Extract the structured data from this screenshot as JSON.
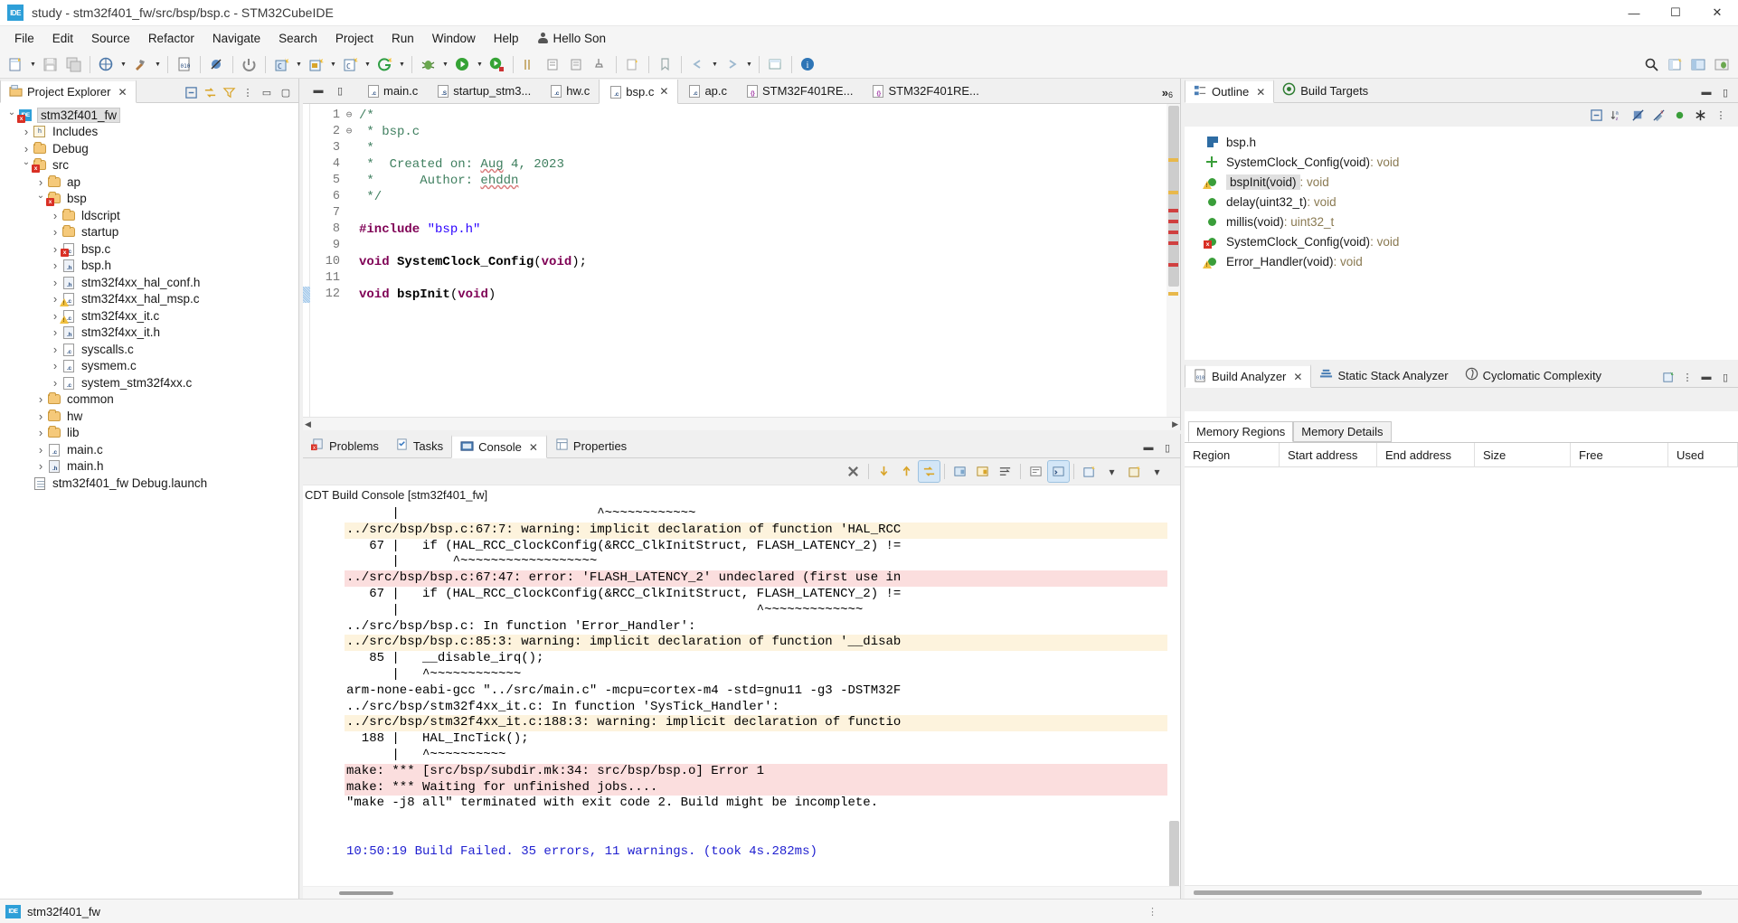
{
  "window": {
    "title": "study - stm32f401_fw/src/bsp/bsp.c - STM32CubeIDE",
    "app_badge": "IDE",
    "minimize": "—",
    "maximize": "☐",
    "close": "✕"
  },
  "menu": {
    "items": [
      "File",
      "Edit",
      "Source",
      "Refactor",
      "Navigate",
      "Search",
      "Project",
      "Run",
      "Window",
      "Help"
    ],
    "user": "Hello Son"
  },
  "toolbar": {
    "groups": [
      {
        "name": "new",
        "icons": [
          "new-file-icon"
        ],
        "dropdown": true
      },
      {
        "name": "save",
        "icons": [
          "save-icon",
          "save-all-icon"
        ],
        "dropdown": false
      },
      {
        "name": "build-tools",
        "icons": [
          "build-project-icon"
        ],
        "dropdown": true
      },
      {
        "name": "hammer",
        "icons": [
          "build-hammer-icon"
        ],
        "dropdown": true
      },
      {
        "name": "binary",
        "icons": [
          "binary-icon"
        ],
        "dropdown": false
      },
      {
        "name": "skip",
        "icons": [
          "skip-breakpoints-icon"
        ],
        "dropdown": false
      },
      {
        "name": "stop",
        "icons": [
          "terminate-icon"
        ],
        "dropdown": false
      },
      {
        "name": "launch-c",
        "icons": [
          "debug-config-icon"
        ],
        "dropdown": true
      },
      {
        "name": "launch-c2",
        "icons": [
          "run-config-icon"
        ],
        "dropdown": true
      },
      {
        "name": "launch-c3",
        "icons": [
          "new-c-project-icon"
        ],
        "dropdown": true
      },
      {
        "name": "g",
        "icons": [
          "generate-code-icon"
        ],
        "dropdown": true
      },
      {
        "name": "debug",
        "icons": [
          "debug-bug-icon"
        ],
        "dropdown": true
      },
      {
        "name": "run",
        "icons": [
          "run-play-icon"
        ],
        "dropdown": true
      },
      {
        "name": "run2",
        "icons": [
          "run-external-icon"
        ],
        "dropdown": false
      }
    ],
    "right_icons": [
      "search-icon",
      "open-perspective-icon",
      "perspective-cdt-icon",
      "perspective-debug-icon"
    ]
  },
  "explorer": {
    "tab": "Project Explorer",
    "tools": [
      "collapse-all-icon",
      "link-with-editor-icon",
      "filter-icon",
      "view-menu-icon",
      "minimize-icon",
      "maximize-icon"
    ],
    "tree": [
      {
        "label": "stm32f401_fw",
        "depth": 0,
        "twisty": "open",
        "icon": "ide-project-icon",
        "badge": "error",
        "selected": true
      },
      {
        "label": "Includes",
        "depth": 1,
        "twisty": "closed",
        "icon": "includes-icon",
        "badge": ""
      },
      {
        "label": "Debug",
        "depth": 1,
        "twisty": "closed",
        "icon": "folder-icon",
        "badge": ""
      },
      {
        "label": "src",
        "depth": 1,
        "twisty": "open",
        "icon": "folder-icon",
        "badge": "error"
      },
      {
        "label": "ap",
        "depth": 2,
        "twisty": "closed",
        "icon": "folder-icon",
        "badge": ""
      },
      {
        "label": "bsp",
        "depth": 2,
        "twisty": "open",
        "icon": "folder-icon",
        "badge": "error"
      },
      {
        "label": "ldscript",
        "depth": 3,
        "twisty": "closed",
        "icon": "folder-icon",
        "badge": ""
      },
      {
        "label": "startup",
        "depth": 3,
        "twisty": "closed",
        "icon": "folder-icon",
        "badge": ""
      },
      {
        "label": "bsp.c",
        "depth": 3,
        "twisty": "closed",
        "icon": "c-file-icon",
        "badge": "error"
      },
      {
        "label": "bsp.h",
        "depth": 3,
        "twisty": "closed",
        "icon": "h-file-icon",
        "badge": ""
      },
      {
        "label": "stm32f4xx_hal_conf.h",
        "depth": 3,
        "twisty": "closed",
        "icon": "h-file-icon",
        "badge": ""
      },
      {
        "label": "stm32f4xx_hal_msp.c",
        "depth": 3,
        "twisty": "closed",
        "icon": "c-file-icon",
        "badge": "warning"
      },
      {
        "label": "stm32f4xx_it.c",
        "depth": 3,
        "twisty": "closed",
        "icon": "c-file-icon",
        "badge": "warning"
      },
      {
        "label": "stm32f4xx_it.h",
        "depth": 3,
        "twisty": "closed",
        "icon": "h-file-icon",
        "badge": ""
      },
      {
        "label": "syscalls.c",
        "depth": 3,
        "twisty": "closed",
        "icon": "c-file-icon",
        "badge": ""
      },
      {
        "label": "sysmem.c",
        "depth": 3,
        "twisty": "closed",
        "icon": "c-file-icon",
        "badge": ""
      },
      {
        "label": "system_stm32f4xx.c",
        "depth": 3,
        "twisty": "closed",
        "icon": "c-file-icon",
        "badge": ""
      },
      {
        "label": "common",
        "depth": 2,
        "twisty": "closed",
        "icon": "folder-icon",
        "badge": ""
      },
      {
        "label": "hw",
        "depth": 2,
        "twisty": "closed",
        "icon": "folder-icon",
        "badge": ""
      },
      {
        "label": "lib",
        "depth": 2,
        "twisty": "closed",
        "icon": "folder-icon",
        "badge": ""
      },
      {
        "label": "main.c",
        "depth": 2,
        "twisty": "closed",
        "icon": "c-file-icon",
        "badge": ""
      },
      {
        "label": "main.h",
        "depth": 2,
        "twisty": "closed",
        "icon": "h-file-icon",
        "badge": ""
      },
      {
        "label": "stm32f401_fw Debug.launch",
        "depth": 1,
        "twisty": "none",
        "icon": "launch-file-icon",
        "badge": ""
      }
    ]
  },
  "editor": {
    "tabs": [
      {
        "label": "main.c",
        "icon": "c-file-icon",
        "active": false,
        "closable": false
      },
      {
        "label": "startup_stm3...",
        "icon": "s-file-icon",
        "active": false,
        "closable": false
      },
      {
        "label": "hw.c",
        "icon": "c-file-icon",
        "active": false,
        "closable": false
      },
      {
        "label": "bsp.c",
        "icon": "c-file-icon",
        "active": true,
        "closable": true
      },
      {
        "label": "ap.c",
        "icon": "c-file-icon",
        "active": false,
        "closable": false
      },
      {
        "label": "STM32F401RE...",
        "icon": "ioc-file-icon",
        "active": false,
        "closable": false
      },
      {
        "label": "STM32F401RE...",
        "icon": "ioc-file-icon",
        "active": false,
        "closable": false
      }
    ],
    "overflow_label": "»",
    "overflow_count": "6",
    "lines": [
      {
        "no": "1",
        "fold": "⊖",
        "tokens": [
          {
            "t": "/*",
            "c": "c-com"
          }
        ]
      },
      {
        "no": "2",
        "fold": "",
        "tokens": [
          {
            "t": " * bsp.c",
            "c": "c-com"
          }
        ]
      },
      {
        "no": "3",
        "fold": "",
        "tokens": [
          {
            "t": " *",
            "c": "c-com"
          }
        ]
      },
      {
        "no": "4",
        "fold": "",
        "tokens": [
          {
            "t": " *  Created on: ",
            "c": "c-com"
          },
          {
            "t": "Aug",
            "c": "c-com sq"
          },
          {
            "t": " 4, 2023",
            "c": "c-com"
          }
        ]
      },
      {
        "no": "5",
        "fold": "",
        "tokens": [
          {
            "t": " *      Author: ",
            "c": "c-com"
          },
          {
            "t": "ehddn",
            "c": "c-com sq"
          }
        ]
      },
      {
        "no": "6",
        "fold": "",
        "tokens": [
          {
            "t": " */",
            "c": "c-com"
          }
        ]
      },
      {
        "no": "7",
        "fold": "",
        "tokens": [
          {
            "t": "",
            "c": "c-pl"
          }
        ]
      },
      {
        "no": "8",
        "fold": "",
        "tokens": [
          {
            "t": "#include ",
            "c": "c-pre"
          },
          {
            "t": "\"bsp.h\"",
            "c": "c-str"
          }
        ]
      },
      {
        "no": "9",
        "fold": "",
        "tokens": [
          {
            "t": "",
            "c": "c-pl"
          }
        ]
      },
      {
        "no": "10",
        "fold": "",
        "tokens": [
          {
            "t": "void",
            "c": "c-kw"
          },
          {
            "t": " ",
            "c": "c-pl"
          },
          {
            "t": "SystemClock_Config",
            "c": "c-fn"
          },
          {
            "t": "(",
            "c": "c-pl"
          },
          {
            "t": "void",
            "c": "c-kw"
          },
          {
            "t": ");",
            "c": "c-pl"
          }
        ]
      },
      {
        "no": "11",
        "fold": "",
        "tokens": [
          {
            "t": "",
            "c": "c-pl"
          }
        ]
      },
      {
        "no": "12",
        "fold": "⊖",
        "tokens": [
          {
            "t": "void",
            "c": "c-kw"
          },
          {
            "t": " ",
            "c": "c-pl"
          },
          {
            "t": "bspInit",
            "c": "c-fn"
          },
          {
            "t": "(",
            "c": "c-pl"
          },
          {
            "t": "void",
            "c": "c-kw"
          },
          {
            "t": ")",
            "c": "c-pl"
          }
        ]
      }
    ]
  },
  "bottom": {
    "tabs": [
      {
        "label": "Problems",
        "icon": "problems-icon",
        "active": false,
        "closable": false
      },
      {
        "label": "Tasks",
        "icon": "tasks-icon",
        "active": false,
        "closable": false
      },
      {
        "label": "Console",
        "icon": "console-icon",
        "active": true,
        "closable": true
      },
      {
        "label": "Properties",
        "icon": "properties-icon",
        "active": false,
        "closable": false
      }
    ],
    "toolbar_icons": [
      "clear-console-icon",
      "scroll-lock-down-icon",
      "scroll-lock-up-icon",
      "show-console-on-output-icon",
      "pin-console-icon",
      "lock-console-icon",
      "word-wrap-icon",
      "display-selected-console-icon",
      "open-console-icon",
      "new-console-view-icon"
    ],
    "console_title": "CDT Build Console [stm32f401_fw]",
    "console_lines": [
      {
        "text": "      |                          ^~~~~~~~~~~~~",
        "style": "plain"
      },
      {
        "text": "../src/bsp/bsp.c:67:7: warning: implicit declaration of function 'HAL_RCC",
        "style": "warn"
      },
      {
        "text": "   67 |   if (HAL_RCC_ClockConfig(&RCC_ClkInitStruct, FLASH_LATENCY_2) !=",
        "style": "plain"
      },
      {
        "text": "      |       ^~~~~~~~~~~~~~~~~~~",
        "style": "plain"
      },
      {
        "text": "../src/bsp/bsp.c:67:47: error: 'FLASH_LATENCY_2' undeclared (first use in",
        "style": "err"
      },
      {
        "text": "   67 |   if (HAL_RCC_ClockConfig(&RCC_ClkInitStruct, FLASH_LATENCY_2) !=",
        "style": "plain"
      },
      {
        "text": "      |                                               ^~~~~~~~~~~~~~",
        "style": "plain"
      },
      {
        "text": "../src/bsp/bsp.c: In function 'Error_Handler':",
        "style": "plain"
      },
      {
        "text": "../src/bsp/bsp.c:85:3: warning: implicit declaration of function '__disab",
        "style": "warn"
      },
      {
        "text": "   85 |   __disable_irq();",
        "style": "plain"
      },
      {
        "text": "      |   ^~~~~~~~~~~~~",
        "style": "plain"
      },
      {
        "text": "arm-none-eabi-gcc \"../src/main.c\" -mcpu=cortex-m4 -std=gnu11 -g3 -DSTM32F",
        "style": "plain"
      },
      {
        "text": "../src/bsp/stm32f4xx_it.c: In function 'SysTick_Handler':",
        "style": "plain"
      },
      {
        "text": "../src/bsp/stm32f4xx_it.c:188:3: warning: implicit declaration of functio",
        "style": "warn"
      },
      {
        "text": "  188 |   HAL_IncTick();",
        "style": "plain"
      },
      {
        "text": "      |   ^~~~~~~~~~~",
        "style": "plain"
      },
      {
        "text": "make: *** [src/bsp/subdir.mk:34: src/bsp/bsp.o] Error 1",
        "style": "err"
      },
      {
        "text": "make: *** Waiting for unfinished jobs....",
        "style": "err"
      },
      {
        "text": "\"make -j8 all\" terminated with exit code 2. Build might be incomplete.",
        "style": "plain"
      },
      {
        "text": "",
        "style": "plain"
      },
      {
        "text": "",
        "style": "plain"
      },
      {
        "text": "10:50:19 Build Failed. 35 errors, 11 warnings. (took 4s.282ms)",
        "style": "blue"
      }
    ]
  },
  "outline": {
    "tabs": [
      {
        "label": "Outline",
        "icon": "outline-icon",
        "active": true,
        "closable": true
      },
      {
        "label": "Build Targets",
        "icon": "build-targets-icon",
        "active": false,
        "closable": false
      }
    ],
    "tools": [
      "collapse-all-icon",
      "sort-icon",
      "hide-fields-icon",
      "hide-static-icon",
      "hide-nonpublic-icon",
      "filter-macros-icon",
      "view-menu-icon"
    ],
    "items": [
      {
        "label": "bsp.h",
        "ret": "",
        "icon": "include-header-icon",
        "badge": "",
        "selected": false
      },
      {
        "label": "SystemClock_Config(void)",
        "ret": " : void",
        "icon": "prototype-icon",
        "badge": "",
        "selected": false
      },
      {
        "label": "bspInit(void)",
        "ret": " : void",
        "icon": "function-icon",
        "badge": "warning",
        "selected": true
      },
      {
        "label": "delay(uint32_t)",
        "ret": " : void",
        "icon": "function-icon",
        "badge": "",
        "selected": false
      },
      {
        "label": "millis(void)",
        "ret": " : uint32_t",
        "icon": "function-icon",
        "badge": "",
        "selected": false
      },
      {
        "label": "SystemClock_Config(void)",
        "ret": " : void",
        "icon": "function-icon",
        "badge": "error",
        "selected": false
      },
      {
        "label": "Error_Handler(void)",
        "ret": " : void",
        "icon": "function-icon",
        "badge": "warning",
        "selected": false
      }
    ]
  },
  "analyzer": {
    "tabs": [
      {
        "label": "Build Analyzer",
        "icon": "build-analyzer-icon",
        "active": true,
        "closable": true
      },
      {
        "label": "Static Stack Analyzer",
        "icon": "static-stack-icon",
        "active": false,
        "closable": false
      },
      {
        "label": "Cyclomatic Complexity",
        "icon": "cyclomatic-icon",
        "active": false,
        "closable": false
      }
    ],
    "tools": [
      "refresh-analyzer-icon",
      "view-menu-icon",
      "minimize-icon",
      "maximize-icon"
    ],
    "mem_tabs": [
      {
        "label": "Memory Regions",
        "active": true
      },
      {
        "label": "Memory Details",
        "active": false
      }
    ],
    "columns": [
      "Region",
      "Start address",
      "End address",
      "Size",
      "Free",
      "Used"
    ],
    "rows": []
  },
  "statusbar": {
    "badge": "IDE",
    "text": "stm32f401_fw",
    "grip": "⋮"
  },
  "colors": {
    "accent": "#2e9fd8",
    "error": "#d93025",
    "warning": "#f0c040",
    "console_warn_bg": "#fdf3dd",
    "console_err_bg": "#fbdede",
    "build_fail_text": "#2020d0",
    "comment": "#3f7f5f",
    "keyword": "#7f0055",
    "string": "#2a00ff"
  }
}
